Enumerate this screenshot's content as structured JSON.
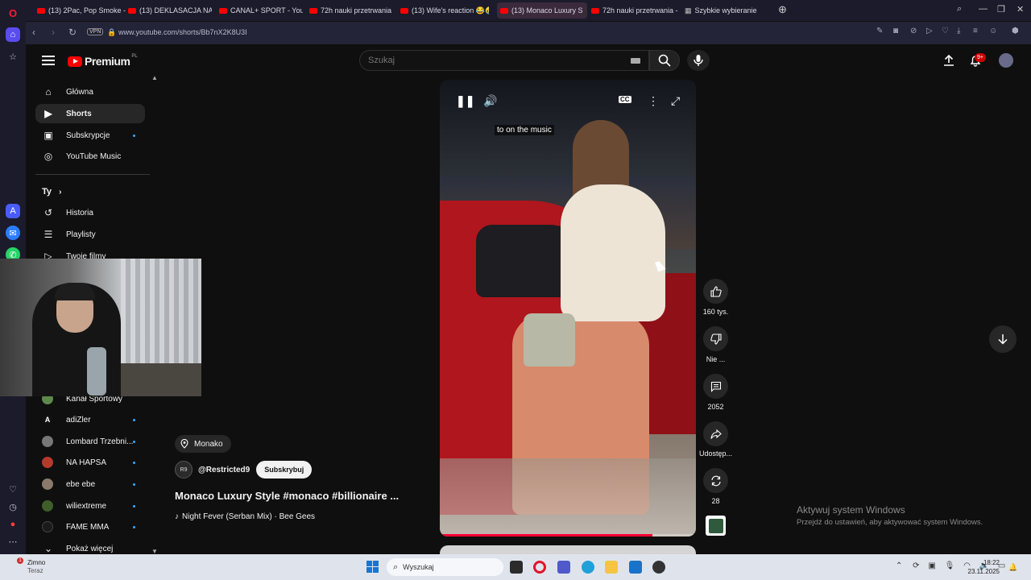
{
  "browser": {
    "tabs": [
      {
        "label": "(13) 2Pac, Pop Smoke - W"
      },
      {
        "label": "(13) DEKLASACJA NA ANI"
      },
      {
        "label": "CANAL+ SPORT - YouTub"
      },
      {
        "label": "72h nauki przetrwania - o"
      },
      {
        "label": "(13) Wife's reaction 😂🤣"
      },
      {
        "label": "(13) Monaco Luxury S"
      },
      {
        "label": "72h nauki przetrwania - o"
      },
      {
        "label": "Szybkie wybieranie"
      }
    ],
    "vpn_label": "VPN",
    "url": "www.youtube.com/shorts/Bb7nX2K8U3I"
  },
  "header": {
    "logo": "Premium",
    "region": "PL",
    "search_placeholder": "Szukaj",
    "notification_count": "9+"
  },
  "sidebar": {
    "main": [
      {
        "label": "Główna",
        "icon": "home-icon"
      },
      {
        "label": "Shorts",
        "icon": "shorts-icon"
      },
      {
        "label": "Subskrypcje",
        "icon": "subscriptions-icon"
      },
      {
        "label": "YouTube Music",
        "icon": "music-icon"
      }
    ],
    "you_heading": "Ty",
    "you": [
      {
        "label": "Historia",
        "icon": "history-icon"
      },
      {
        "label": "Playlisty",
        "icon": "playlist-icon"
      },
      {
        "label": "Twoje filmy",
        "icon": "your-videos-icon"
      }
    ],
    "subscriptions": [
      {
        "label": "Kanał Sportowy"
      },
      {
        "label": "adiZler"
      },
      {
        "label": "Lombard Trzebni..."
      },
      {
        "label": "NA HAPSA"
      },
      {
        "label": "ebe ebe"
      },
      {
        "label": "wiliextreme"
      },
      {
        "label": "FAME MMA"
      }
    ],
    "show_more": "Pokaż więcej"
  },
  "video": {
    "caption": "to on the music",
    "progress": 0.83,
    "location": "Monako",
    "channel": "@Restricted9",
    "channel_avatar_text": "R9",
    "subscribe_label": "Subskrybuj",
    "title": "Monaco Luxury Style #monaco #billionaire ...",
    "music": "Night Fever (Serban Mix) · Bee Gees"
  },
  "actions": {
    "likes": "160 tys.",
    "dislike": "Nie ...",
    "comments": "2052",
    "share": "Udostęp...",
    "remix": "28"
  },
  "activate_windows": {
    "title": "Aktywuj system Windows",
    "subtitle": "Przejdź do ustawień, aby aktywować system Windows."
  },
  "taskbar": {
    "weather": "Zimno",
    "weather_sub": "Teraz",
    "weather_badge": "1",
    "search_placeholder": "Wyszukaj",
    "time": "18:22",
    "date": "23.11.2025"
  },
  "colors": {
    "accent": "#ff0000",
    "progress": "#ff0033",
    "notification": "#cc0000"
  }
}
